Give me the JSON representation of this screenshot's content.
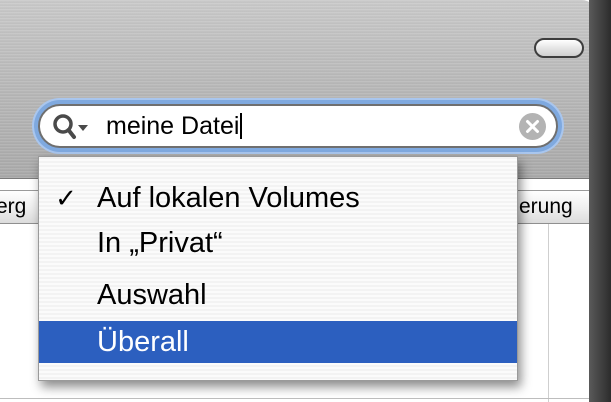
{
  "search": {
    "value": "meine Datei",
    "scope_menu": {
      "items": [
        {
          "label": "Auf lokalen Volumes",
          "checked": true,
          "highlighted": false
        },
        {
          "label": "In „Privat“",
          "checked": false,
          "highlighted": false
        },
        {
          "label": "Auswahl",
          "checked": false,
          "highlighted": false
        },
        {
          "label": "Überall",
          "checked": false,
          "highlighted": true
        }
      ],
      "check_mark": "✓"
    }
  },
  "table": {
    "header_left_fragment": "erg",
    "header_right_fragment": "erung"
  },
  "colors": {
    "highlight": "#2c5fbf",
    "focus_ring": "#7fa9df"
  },
  "icons": {
    "search": "magnifier-with-dropdown",
    "clear": "clear-x-circle",
    "toolbar_toggle": "toolbar-toggle-pill"
  }
}
